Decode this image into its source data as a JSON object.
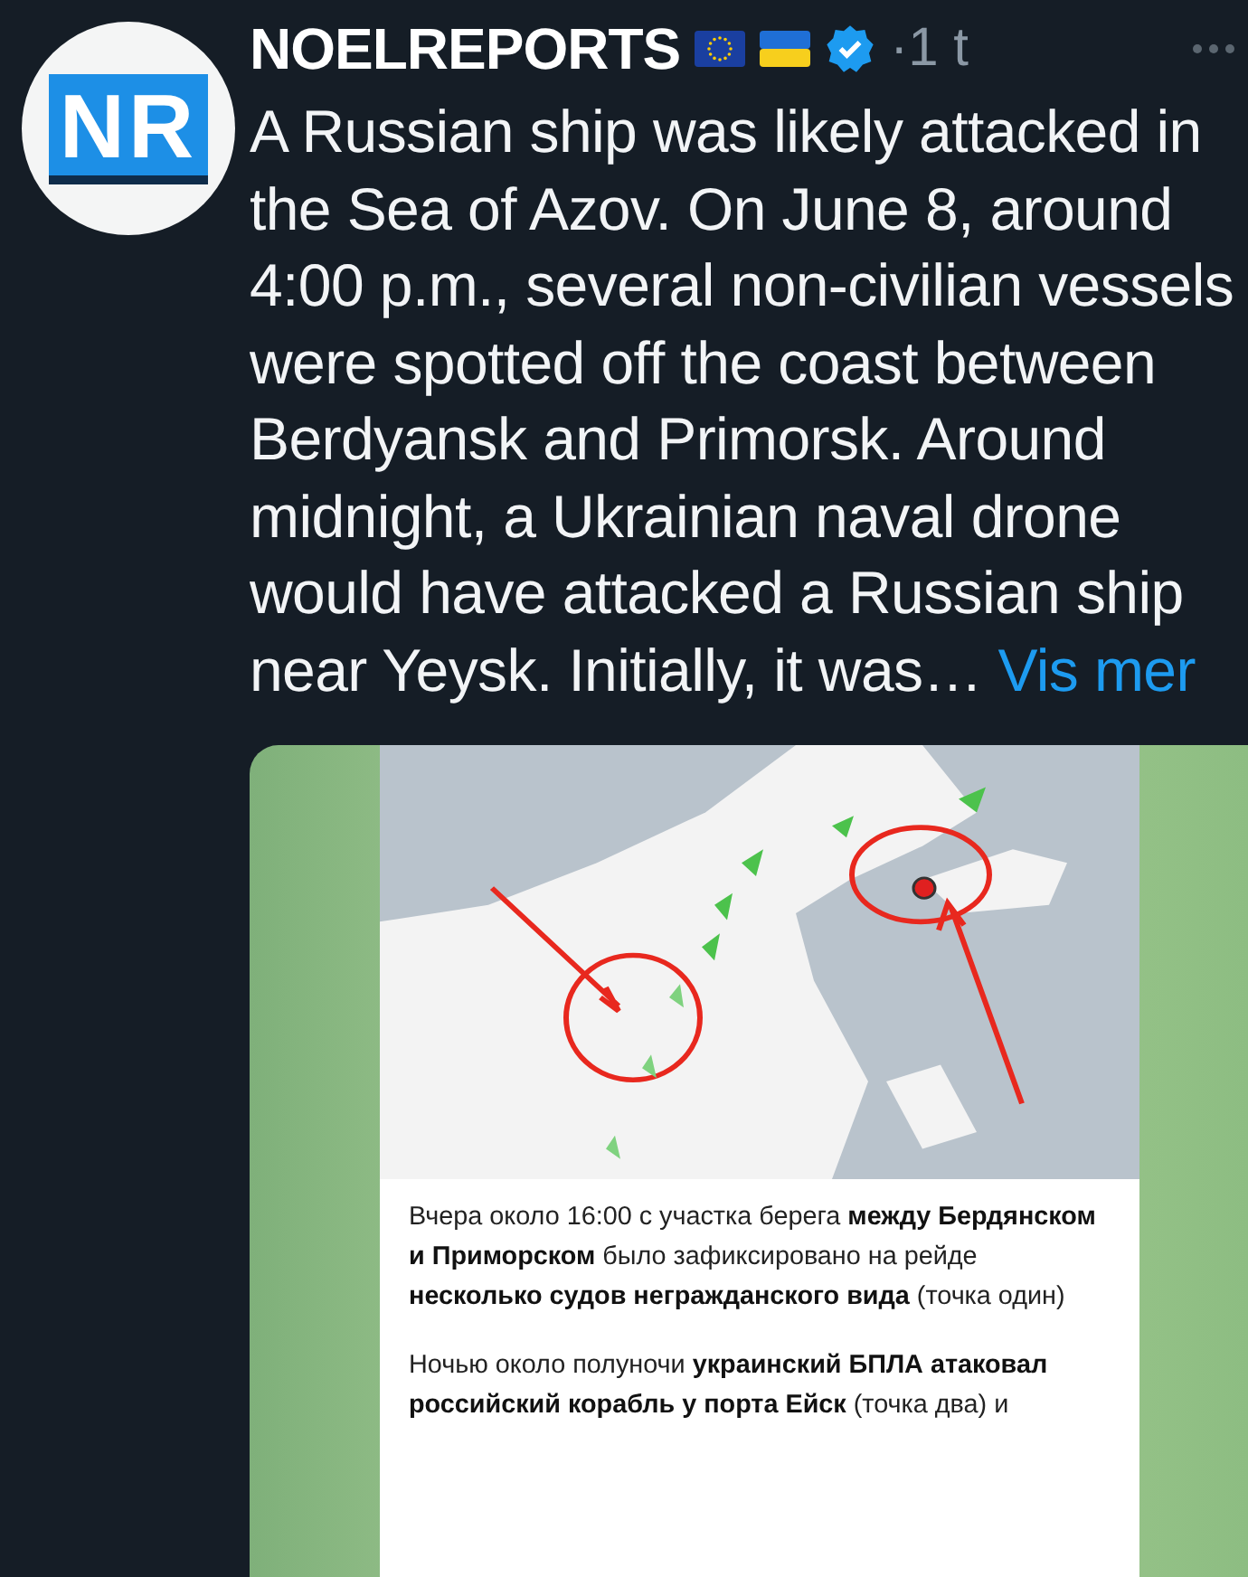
{
  "author": {
    "avatar_text": "NR",
    "name": "NOELREPORTS",
    "verified": true,
    "time": "·1 t"
  },
  "post": {
    "text": "A Russian ship was likely attacked in the Sea of Azov. On June 8, around 4:00 p.m., several non-civilian vessels were spotted off the coast between Berdyansk and Primorsk. Around midnight, a Ukrainian naval drone would have attacked a Russian ship near Yeysk. Initially, it was…",
    "more_link": "Vis mer"
  },
  "attachment": {
    "paragraphs": [
      "Вчера около 16:00 с участка берега **между Бердянском и Приморском** было зафиксировано на рейде **несколько судов негражданского вида** (точка один)",
      "Ночью около полуночи **украинский БПЛА атаковал российский корабль у порта Ейск** (точка два) и"
    ]
  }
}
